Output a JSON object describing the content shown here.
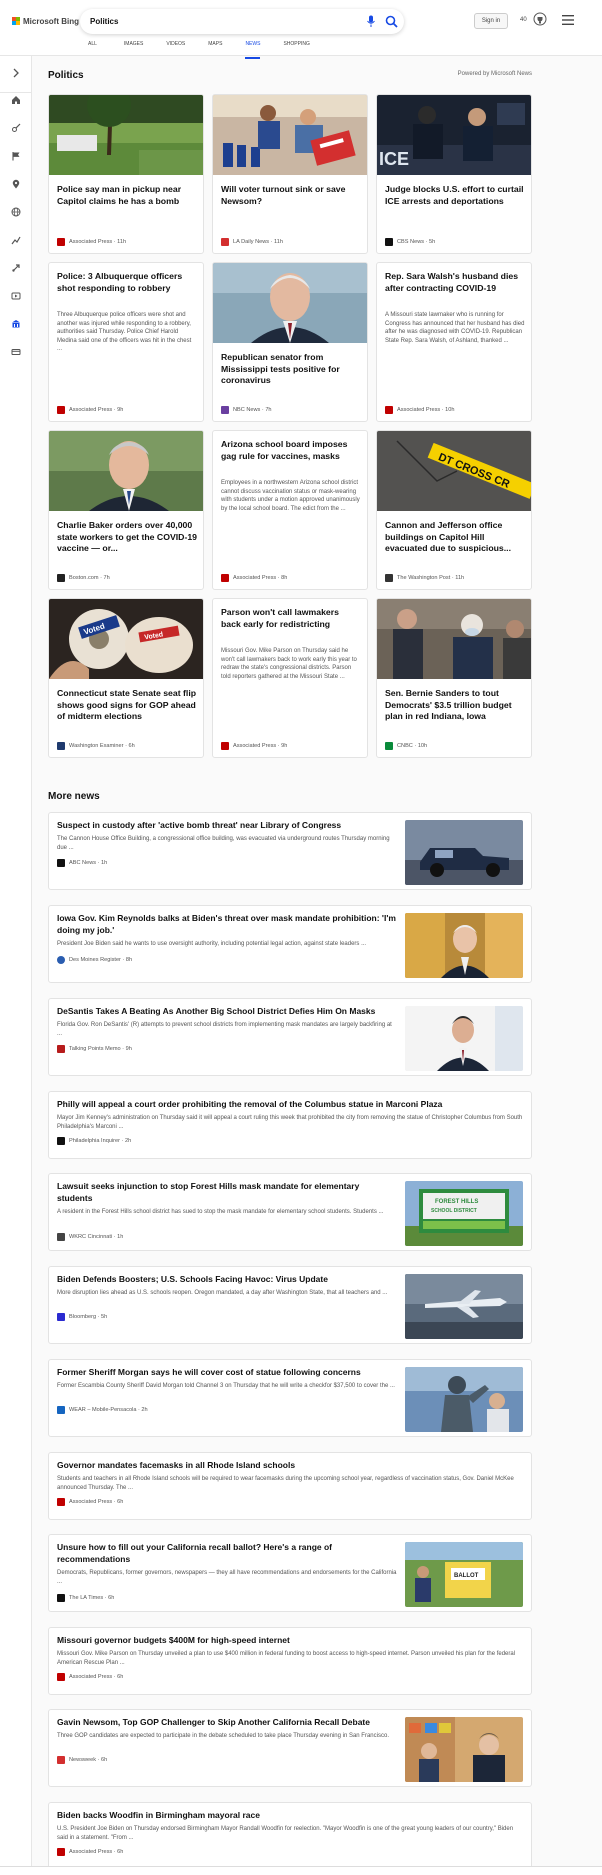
{
  "header": {
    "brand": "Microsoft Bing",
    "search_value": "Politics",
    "signin_label": "Sign in",
    "points": "40",
    "tabs": [
      "ALL",
      "IMAGES",
      "VIDEOS",
      "MAPS",
      "NEWS",
      "SHOPPING"
    ],
    "active_tab": "NEWS"
  },
  "rail": {
    "items": [
      "collapse-icon",
      "home-icon",
      "sports-icon",
      "flag-icon",
      "location-icon",
      "globe-icon",
      "business-icon",
      "science-icon",
      "entertainment-icon",
      "politics-icon",
      "money-icon"
    ]
  },
  "section": {
    "title": "Politics",
    "powered_by": "Powered by Microsoft News"
  },
  "cards": [
    {
      "title": "Police say man in pickup near Capitol claims he has a bomb",
      "snippet": "",
      "source": "Associated Press · 11h",
      "logo_color": "#c00000"
    },
    {
      "title": "Will voter turnout sink or save Newsom?",
      "snippet": "",
      "source": "LA Daily News · 11h",
      "logo_color": "#d32f2f"
    },
    {
      "title": "Judge blocks U.S. effort to curtail ICE arrests and deportations",
      "snippet": "",
      "source": "CBS News · 5h",
      "logo_color": "#111111"
    },
    {
      "title": "Police: 3 Albuquerque officers shot responding to robbery",
      "snippet": "Three Albuquerque police officers were shot and another was injured while responding to a robbery, authorities said Thursday. Police Chief Harold Medina said one of the officers was hit in the chest ...",
      "source": "Associated Press · 9h",
      "logo_color": "#c00000"
    },
    {
      "title": "Republican senator from Mississippi tests positive for coronavirus",
      "snippet": "",
      "source": "NBC News · 7h",
      "logo_color": "#6a3fa0"
    },
    {
      "title": "Rep. Sara Walsh's husband dies after contracting COVID-19",
      "snippet": "A Missouri state lawmaker who is running for Congress has announced that her husband has died after he was diagnosed with COVID-19. Republican State Rep. Sara Walsh, of Ashland, thanked ...",
      "source": "Associated Press · 10h",
      "logo_color": "#c00000"
    },
    {
      "title": "Charlie Baker orders over 40,000 state workers to get the COVID-19 vaccine — or...",
      "snippet": "",
      "source": "Boston.com · 7h",
      "logo_color": "#222222"
    },
    {
      "title": "Arizona school board imposes gag rule for vaccines, masks",
      "snippet": "Employees in a northwestern Arizona school district cannot discuss vaccination status or mask-wearing with students under a motion approved unanimously by the local school board. The edict from the ...",
      "source": "Associated Press · 8h",
      "logo_color": "#c00000"
    },
    {
      "title": "Cannon and Jefferson office buildings on Capitol Hill evacuated due to suspicious...",
      "snippet": "",
      "source": "The Washington Post · 11h",
      "logo_color": "#333333"
    },
    {
      "title": "Connecticut state Senate seat flip shows good signs for GOP ahead of midterm elections",
      "snippet": "",
      "source": "Washington Examiner · 6h",
      "logo_color": "#1f3a6e"
    },
    {
      "title": "Parson won't call lawmakers back early for redistricting",
      "snippet": "Missouri Gov. Mike Parson on Thursday said he won't call lawmakers back to work early this year to redraw the state's congressional districts. Parson told reporters gathered at the Missouri State ...",
      "source": "Associated Press · 9h",
      "logo_color": "#c00000"
    },
    {
      "title": "Sen. Bernie Sanders to tout Democrats' $3.5 trillion budget plan in red Indiana, Iowa",
      "snippet": "",
      "source": "CNBC · 10h",
      "logo_color": "#0a8a3a"
    }
  ],
  "more_news": {
    "title": "More news",
    "items": [
      {
        "title": "Suspect in custody after 'active bomb threat' near Library of Congress",
        "snippet": "The Cannon House Office Building, a congressional office building, was evacuated via underground routes Thursday morning due ...",
        "source": "ABC News · 1h",
        "logo_color": "#111111",
        "has_image": true,
        "image": "truck"
      },
      {
        "title": "Iowa Gov. Kim Reynolds balks at Biden's threat over mask mandate prohibition: 'I'm doing my job.'",
        "snippet": "President Joe Biden said he wants to use oversight authority, including potential legal action, against state leaders ...",
        "source": "Des Moines Register · 8h",
        "logo_color": "#2a5db0",
        "has_image": true,
        "image": "biden"
      },
      {
        "title": "DeSantis Takes A Beating As Another Big School District Defies Him On Masks",
        "snippet": "Florida Gov. Ron DeSantis' (R) attempts to prevent school districts from implementing mask mandates are largely backfiring at ...",
        "source": "Talking Points Memo · 9h",
        "logo_color": "#b71c1c",
        "has_image": true,
        "image": "desantis"
      },
      {
        "title": "Philly will appeal a court order prohibiting the removal of the Columbus statue in Marconi Plaza",
        "snippet": "Mayor Jim Kenney's administration on Thursday said it will appeal a court ruling this week that prohibited the city from removing the statue of Christopher Columbus from South Philadelphia's Marconi ...",
        "source": "Philadelphia Inquirer · 2h",
        "logo_color": "#111111",
        "has_image": false,
        "image": ""
      },
      {
        "title": "Lawsuit seeks injunction to stop Forest Hills mask mandate for elementary students",
        "snippet": "A resident in the Forest Hills school district has sued to stop the mask mandate for elementary school students. Students ...",
        "source": "WKRC Cincinnati · 1h",
        "logo_color": "#444444",
        "has_image": true,
        "image": "sign"
      },
      {
        "title": "Biden Defends Boosters; U.S. Schools Facing Havoc: Virus Update",
        "snippet": "More disruption lies ahead as U.S. schools reopen. Oregon mandated, a day after Washington State, that all teachers and ...",
        "source": "Bloomberg · 5h",
        "logo_color": "#2a2ad0",
        "has_image": true,
        "image": "plane"
      },
      {
        "title": "Former Sheriff Morgan says he will cover cost of statue following concerns",
        "snippet": "Former Escambia County Sheriff David Morgan told Channel 3 on Thursday that he will write a checkfor $37,500 to cover the ...",
        "source": "WEAR – Mobile-Pensacola · 2h",
        "logo_color": "#1565c0",
        "has_image": true,
        "image": "statue"
      },
      {
        "title": "Governor mandates facemasks in all Rhode Island schools",
        "snippet": "Students and teachers in all Rhode Island schools will be required to wear facemasks during the upcoming school year, regardless of vaccination status, Gov. Daniel McKee announced Thursday. The ...",
        "source": "Associated Press · 6h",
        "logo_color": "#c00000",
        "has_image": false,
        "image": ""
      },
      {
        "title": "Unsure how to fill out your California recall ballot? Here's a range of recommendations",
        "snippet": "Democrats, Republicans, former governors, newspapers — they all have recommendations and endorsements for the California ...",
        "source": "The LA Times · 6h",
        "logo_color": "#111111",
        "has_image": true,
        "image": "ballot"
      },
      {
        "title": "Missouri governor budgets $400M for high-speed internet",
        "snippet": "Missouri Gov. Mike Parson on Thursday unveiled a plan to use $400 million in federal funding to boost access to high-speed internet. Parson unveiled his plan for the federal American Rescue Plan ...",
        "source": "Associated Press · 6h",
        "logo_color": "#c00000",
        "has_image": false,
        "image": ""
      },
      {
        "title": "Gavin Newsom, Top GOP Challenger to Skip Another California Recall Debate",
        "snippet": "Three GOP candidates are expected to participate in the debate scheduled to take place Thursday evening in San Francisco.",
        "source": "Newsweek · 6h",
        "logo_color": "#d32f2f",
        "has_image": true,
        "image": "newsom"
      },
      {
        "title": "Biden backs Woodfin in Birmingham mayoral race",
        "snippet": "U.S. President Joe Biden on Thursday endorsed Birmingham Mayor Randall Woodfin for reelection. \"Mayor Woodfin is one of the great young leaders of our country,\" Biden said in a statement. \"From ...",
        "source": "Associated Press · 6h",
        "logo_color": "#c00000",
        "has_image": false,
        "image": ""
      }
    ]
  }
}
